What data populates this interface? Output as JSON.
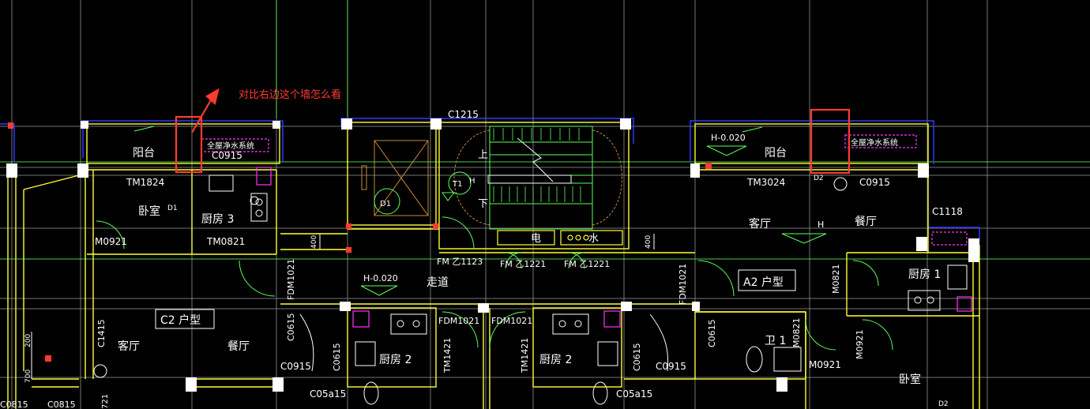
{
  "annotation": {
    "text": "对比右边这个墙怎么看",
    "color": "#ff3b30"
  },
  "colors": {
    "background": "#000000",
    "axis": "#9a9a9a",
    "green_axis": "#5cff5c",
    "wall_yellow": "#ffff33",
    "outline_blue": "#2a3bff",
    "stair_green": "#5cff5c",
    "pipe_magenta": "#ff33ff",
    "highlight_red": "#ff3b30"
  },
  "labels": {
    "c1215": "C1215",
    "balcony_left": "阳台",
    "water_sys_left": "全屋净水系统",
    "c0915_left": "C0915",
    "tm1824": "TM1824",
    "d1_left": "D1",
    "bedroom_left": "卧室",
    "kitchen3": "厨房 3",
    "tm0821": "TM0821",
    "m0921_left": "M0921",
    "fdm1021_left": "FDM1021",
    "dim400_left": "400",
    "elev_d1": "D1",
    "t1": "T1",
    "h_stair": "H",
    "up": "上",
    "down": "下",
    "electric": "电",
    "water": "水",
    "fm1123": "FM 乙1123",
    "fm1221_a": "FM 乙1221",
    "fm1221_b": "FM 乙1221",
    "h_corridor": "H-0.020",
    "corridor": "走道",
    "h_right": "H-0.020",
    "balcony_right": "阳台",
    "water_sys_right": "全屋净水系统",
    "tm3024": "TM3024",
    "d2": "D2",
    "c0915_right": "C0915",
    "living_right": "客厅",
    "h_living": "H",
    "dining_right": "餐厅",
    "c1118": "C1118",
    "dim400_right": "400",
    "fdm1021_right": "FDM1021",
    "a2_unit": "A2 户型",
    "m0821_a": "M0821",
    "kitchen1": "厨房 1",
    "c2_unit": "C2 户型",
    "c1415": "C1415",
    "living_left": "客厅",
    "dining_left": "餐厅",
    "c0615_a": "C0615",
    "c0915_b": "C0915",
    "c0615_b": "C0615",
    "kitchen2_left": "厨房 2",
    "tm1421_a": "TM1421",
    "fdm1021_c": "FDM1021",
    "fdm1021_d": "FDM1021",
    "tm1421_b": "TM1421",
    "kitchen2_right": "厨房 2",
    "c0615_c": "C0615",
    "c0915_c": "C0915",
    "c0615_d": "C0615",
    "bath1": "卫 1",
    "m0821_b": "M0821",
    "m0921_b": "M0921",
    "m0921_c": "M0921",
    "bedroom_right": "卧室",
    "c05a15_a": "C05a15",
    "c05a15_b": "C05a15",
    "c0815_a": "C0815",
    "c0815_b": "C0815",
    "dim200": "200",
    "dim700": "700",
    "d2_bottom": "D2",
    "n721": "721"
  }
}
